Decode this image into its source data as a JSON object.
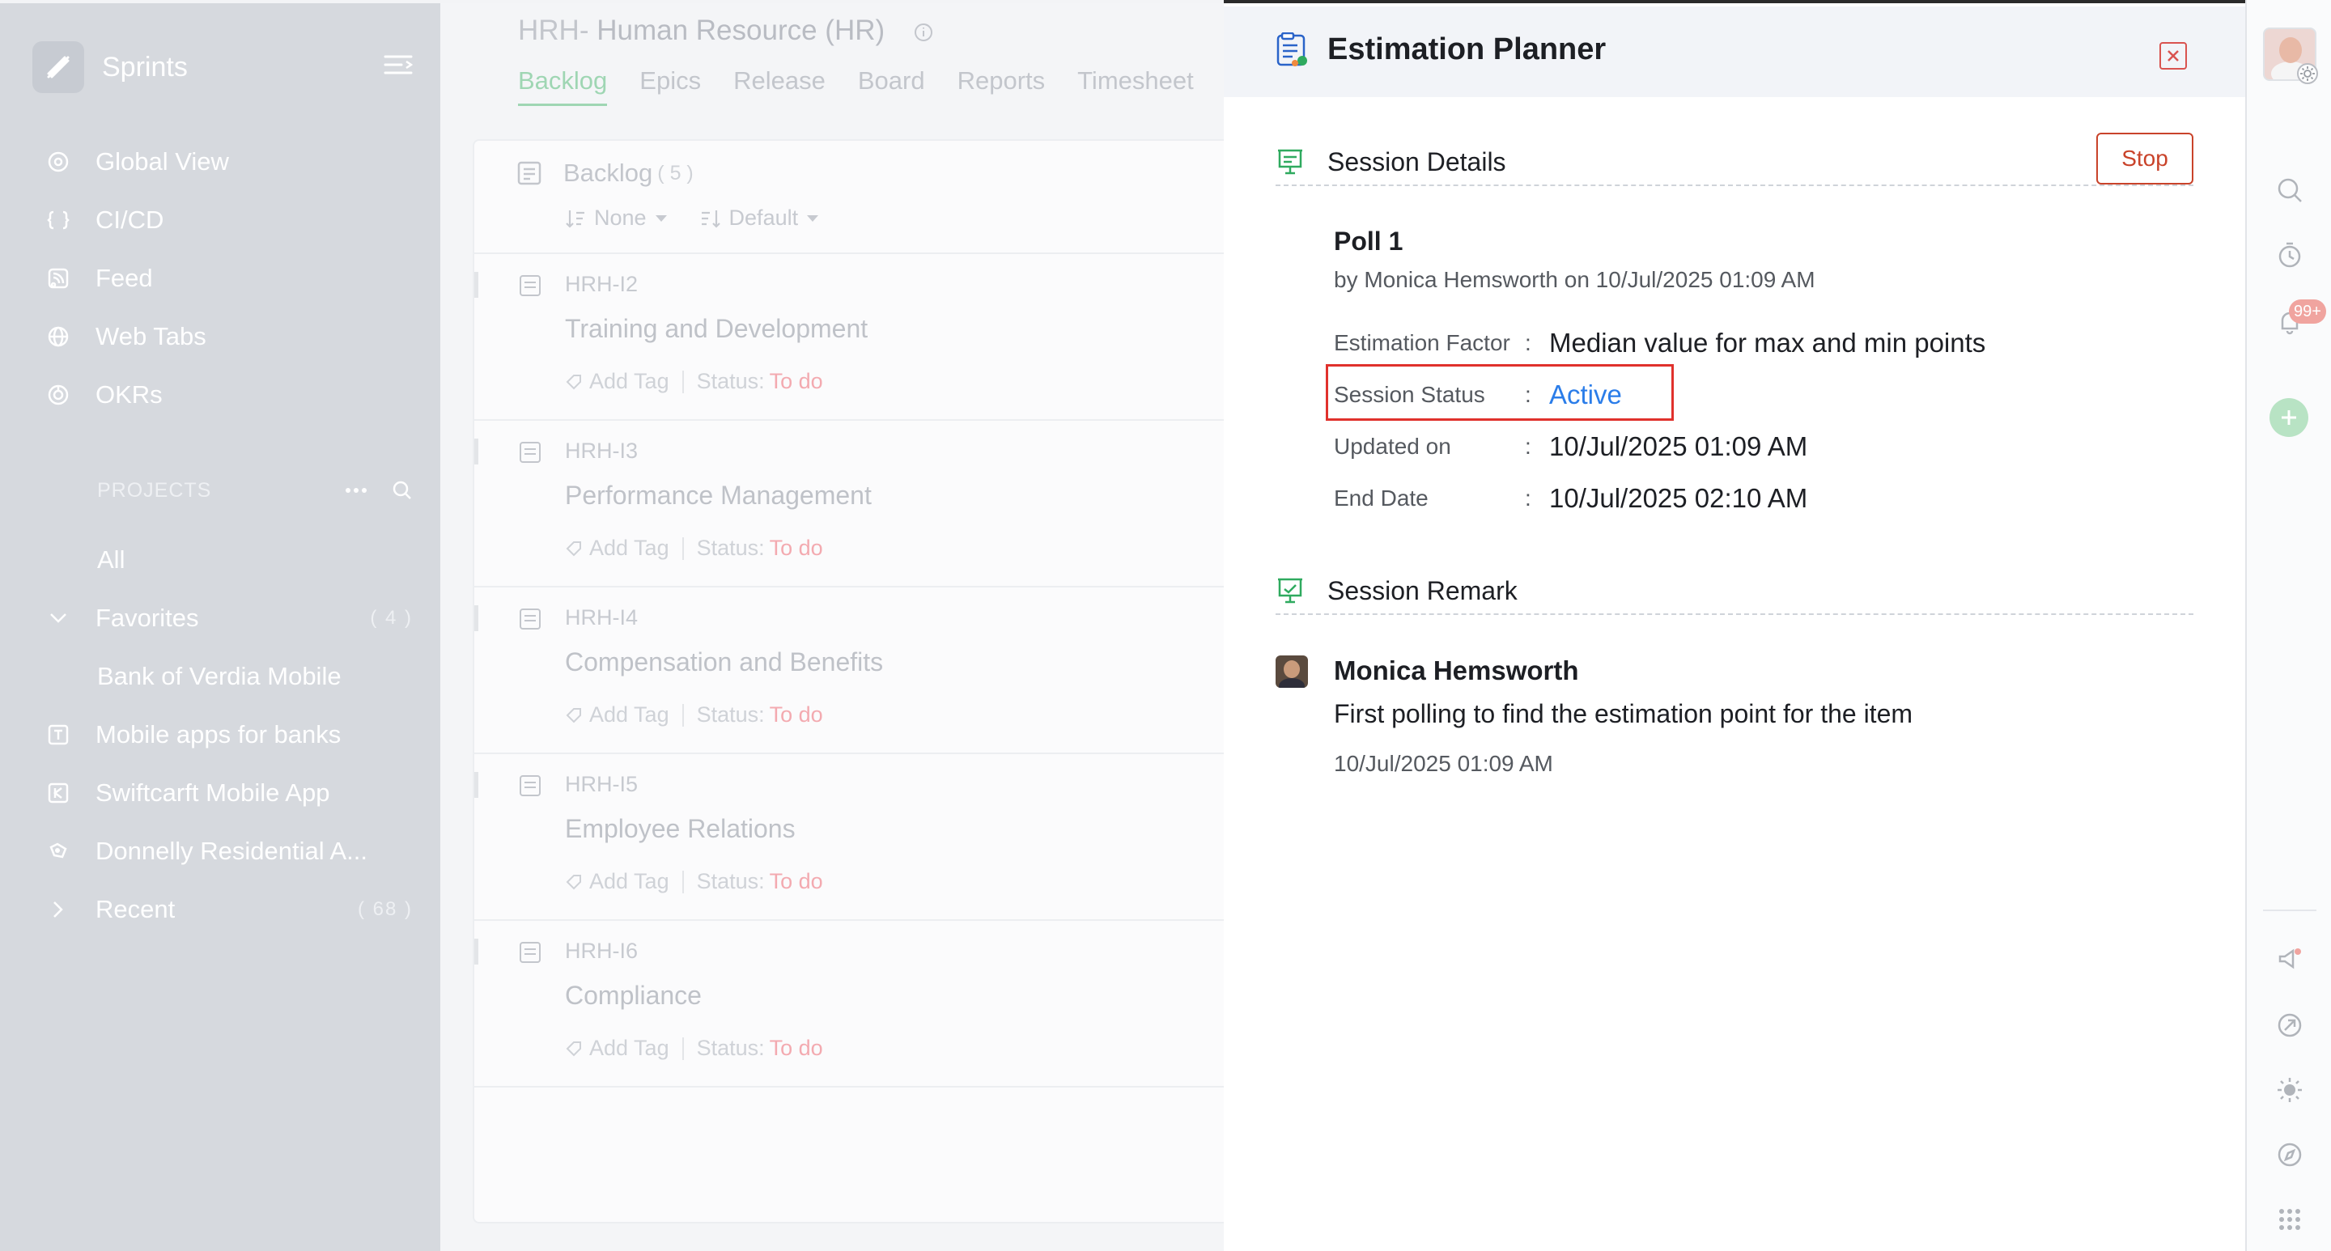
{
  "sidebar": {
    "title": "Sprints",
    "nav": [
      {
        "label": "Global View",
        "icon": "global-view-icon"
      },
      {
        "label": "CI/CD",
        "icon": "cicd-icon"
      },
      {
        "label": "Feed",
        "icon": "feed-icon"
      },
      {
        "label": "Web Tabs",
        "icon": "web-tabs-icon"
      },
      {
        "label": "OKRs",
        "icon": "okrs-icon"
      }
    ],
    "projects_label": "PROJECTS",
    "all_label": "All",
    "favorites": {
      "label": "Favorites",
      "count": "( 4 )"
    },
    "favorite_item": "Bank of Verdia Mobile",
    "projects": [
      {
        "label": "Mobile apps for banks",
        "icon": "project-t-icon"
      },
      {
        "label": "Swiftcarft Mobile App",
        "icon": "project-k-icon"
      },
      {
        "label": "Donnelly Residential A...",
        "icon": "project-puzzle-icon"
      }
    ],
    "recent": {
      "label": "Recent",
      "count": "( 68 )"
    }
  },
  "main": {
    "project_prefix": "HRH-",
    "project_name": "Human Resource (HR)",
    "tabs": [
      "Backlog",
      "Epics",
      "Release",
      "Board",
      "Reports",
      "Timesheet"
    ],
    "active_tab": "Backlog",
    "backlog": {
      "title": "Backlog",
      "count": "( 5 )",
      "filter_group": "None",
      "filter_sort": "Default",
      "add_tag_label": "Add Tag",
      "status_label": "Status:",
      "items": [
        {
          "id": "HRH-I2",
          "name": "Training and Development",
          "status": "To do"
        },
        {
          "id": "HRH-I3",
          "name": "Performance Management",
          "status": "To do"
        },
        {
          "id": "HRH-I4",
          "name": "Compensation and Benefits",
          "status": "To do"
        },
        {
          "id": "HRH-I5",
          "name": "Employee Relations",
          "status": "To do"
        },
        {
          "id": "HRH-I6",
          "name": "Compliance",
          "status": "To do"
        }
      ]
    }
  },
  "panel": {
    "title": "Estimation Planner",
    "session_details_label": "Session Details",
    "stop_label": "Stop",
    "poll_title": "Poll 1",
    "poll_by": "by Monica Hemsworth on 10/Jul/2025 01:09 AM",
    "fields": [
      {
        "key": "Estimation Factor",
        "value": "Median value for max and min points"
      },
      {
        "key": "Session Status",
        "value": "Active"
      },
      {
        "key": "Updated on",
        "value": "10/Jul/2025 01:09 AM"
      },
      {
        "key": "End Date",
        "value": "10/Jul/2025 02:10 AM"
      }
    ],
    "colon": ":",
    "session_remark_label": "Session Remark",
    "remark": {
      "author": "Monica Hemsworth",
      "text": "First polling to find the estimation point for the item",
      "date": "10/Jul/2025 01:09 AM"
    }
  },
  "rail": {
    "notification_badge": "99+"
  },
  "colors": {
    "accent_green": "#2faa5f",
    "stop_red": "#c9432a",
    "active_blue": "#2b7de9",
    "highlight_red": "#e0312c",
    "todo_pink": "#f3aab0"
  }
}
